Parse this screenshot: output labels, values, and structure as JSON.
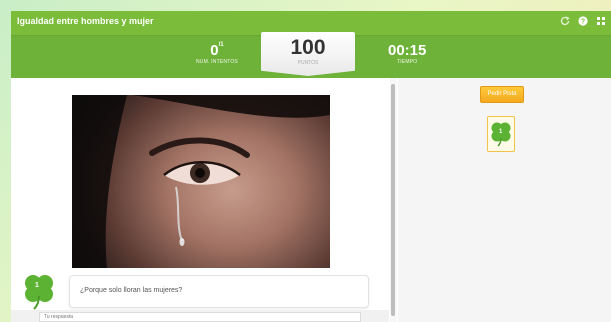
{
  "app": {
    "title": "Igualdad entre hombres y mujer"
  },
  "titlebar": {
    "icons": [
      "refresh-icon",
      "help-icon",
      "grid-menu-icon"
    ]
  },
  "stats": {
    "attempts_value": "0",
    "attempts_sup": "/1",
    "attempts_label": "NUM. INTENTOS",
    "points_value": "100",
    "points_label": "PUNTOS",
    "time_value": "00:15",
    "time_label": "TIEMPO"
  },
  "conversation": {
    "avatar_number": "1",
    "question": "¿Porque solo lloran las mujeres?",
    "answer_placeholder": "Tu respuesta"
  },
  "sidebar": {
    "hint_label": "Pedir Pista",
    "clue_number": "1"
  },
  "colors": {
    "accent": "#7bbd3a",
    "hint": "#f4a920"
  }
}
